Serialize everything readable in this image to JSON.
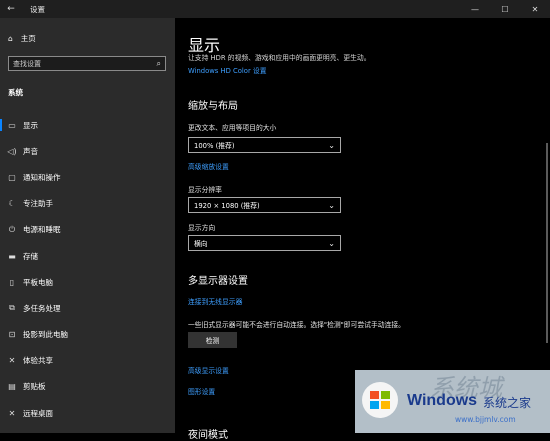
{
  "window": {
    "title": "设置"
  },
  "sidebar": {
    "home_label": "主页",
    "search_placeholder": "查找设置",
    "section_title": "系统",
    "items": [
      {
        "label": "显示",
        "icon": "monitor-icon",
        "active": true
      },
      {
        "label": "声音",
        "icon": "speaker-icon"
      },
      {
        "label": "通知和操作",
        "icon": "notification-icon"
      },
      {
        "label": "专注助手",
        "icon": "moon-icon"
      },
      {
        "label": "电源和睡眠",
        "icon": "power-icon"
      },
      {
        "label": "存储",
        "icon": "storage-icon"
      },
      {
        "label": "平板电脑",
        "icon": "tablet-icon"
      },
      {
        "label": "多任务处理",
        "icon": "multitask-icon"
      },
      {
        "label": "投影到此电脑",
        "icon": "project-icon"
      },
      {
        "label": "体验共享",
        "icon": "share-icon"
      },
      {
        "label": "剪贴板",
        "icon": "clipboard-icon"
      },
      {
        "label": "远程桌面",
        "icon": "remote-icon"
      }
    ]
  },
  "main": {
    "title": "显示",
    "subtitle": "让支持 HDR 的视频、游戏和应用中的画面更明亮、更生动。",
    "hdr_link": "Windows HD Color 设置",
    "scale_layout_title": "缩放与布局",
    "text_size_label": "更改文本、应用等项目的大小",
    "text_size_value": "100% (推荐)",
    "advanced_scale_link": "高级缩放设置",
    "resolution_label": "显示分辨率",
    "resolution_value": "1920 × 1080 (推荐)",
    "orientation_label": "显示方向",
    "orientation_value": "横向",
    "multi_display_title": "多显示器设置",
    "wireless_link": "连接到无线显示器",
    "detect_note": "一些旧式显示器可能不会进行自动连接。选择\"检测\"即可尝试手动连接。",
    "detect_button": "检测",
    "advanced_display_link": "高级显示设置",
    "graphics_link": "图形设置",
    "cut_off_heading": "夜间模式"
  },
  "watermark": {
    "brand": "Windows",
    "brand_suffix": "系统之家",
    "url": "www.bjjmlv.com",
    "bg_text": "系统城"
  },
  "colors": {
    "accent": "#3e9fff",
    "sidebar_bg": "#2b2b2b",
    "main_bg": "#000000"
  }
}
